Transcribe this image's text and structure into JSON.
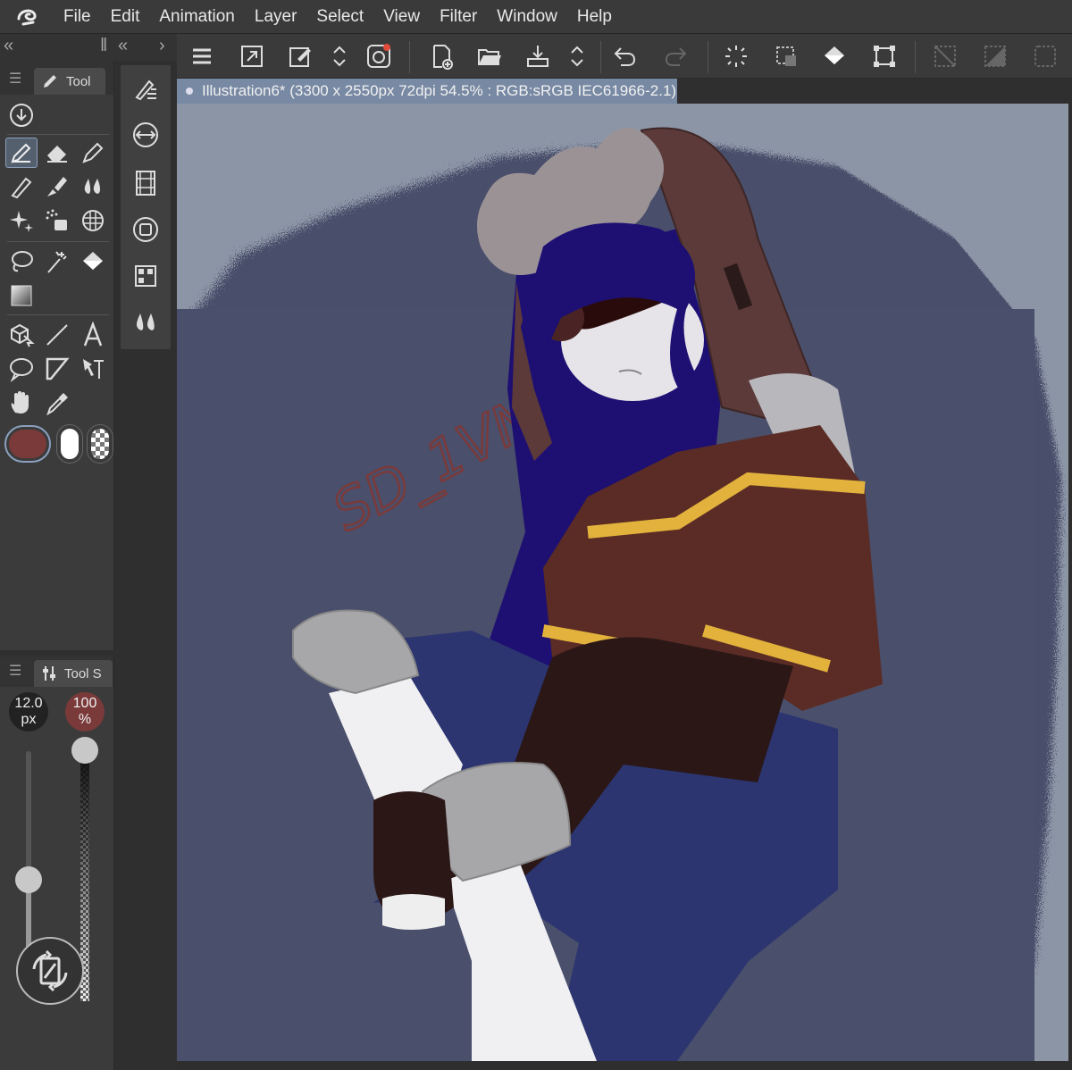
{
  "menubar": {
    "logo_icon": "clip-studio-logo-icon",
    "items": [
      "File",
      "Edit",
      "Animation",
      "Layer",
      "Select",
      "View",
      "Filter",
      "Window",
      "Help"
    ]
  },
  "command_bar": {
    "icons": [
      "hamburger-menu-icon",
      "fit-canvas-icon",
      "edit-canvas-icon",
      "up-down-arrows-icon",
      "clip-studio-assets-icon",
      "new-file-icon",
      "open-file-icon",
      "save-icon",
      "up-down-arrows-icon",
      "undo-icon",
      "redo-icon",
      "loading-spinner-icon",
      "selection-icon",
      "fill-icon",
      "transform-icon",
      "clear-selection-icon",
      "invert-selection-icon",
      "selection-border-icon"
    ]
  },
  "tool_palette": {
    "tab_label": "Tool",
    "tools": [
      "download-icon",
      "pen-icon",
      "eraser-icon",
      "pencil-icon",
      "pencil-slanted-icon",
      "brush-icon",
      "blend-icon",
      "sparkle-icon",
      "spray-icon",
      "grid-icon",
      "lasso-icon",
      "magic-wand-icon",
      "fill-bucket-icon",
      "gradient-icon",
      "3d-object-icon",
      "line-icon",
      "text-icon",
      "speech-bubble-icon",
      "frame-border-icon",
      "correct-line-icon",
      "hand-icon",
      "eyedropper-icon"
    ],
    "main_color": "#7a3a3a",
    "sub_color": "#ffffff"
  },
  "tool_property": {
    "tab_label": "Tool S",
    "brush_size": {
      "value": "12.0",
      "unit": "px"
    },
    "opacity": {
      "value": "100",
      "unit": "%"
    },
    "brush_size_slider_level": 0.45,
    "opacity_slider_level": 1.0
  },
  "canvas": {
    "tab_title": "Illustration6* (3300 x 2550px 72dpi 54.5% : RGB:sRGB IEC61966-2.1)",
    "signature_text": "SD_1VN",
    "colors": {
      "background": "#8c95a6",
      "backdrop": "#4a4f6b",
      "hair": "#1e0f73",
      "hat": "#5b3a39",
      "hat_fur": "#9b9296",
      "shirt": "#5a2c25",
      "stripe": "#e3b23c",
      "pants": "#2c3570",
      "skin_white": "#eeeeee"
    }
  }
}
